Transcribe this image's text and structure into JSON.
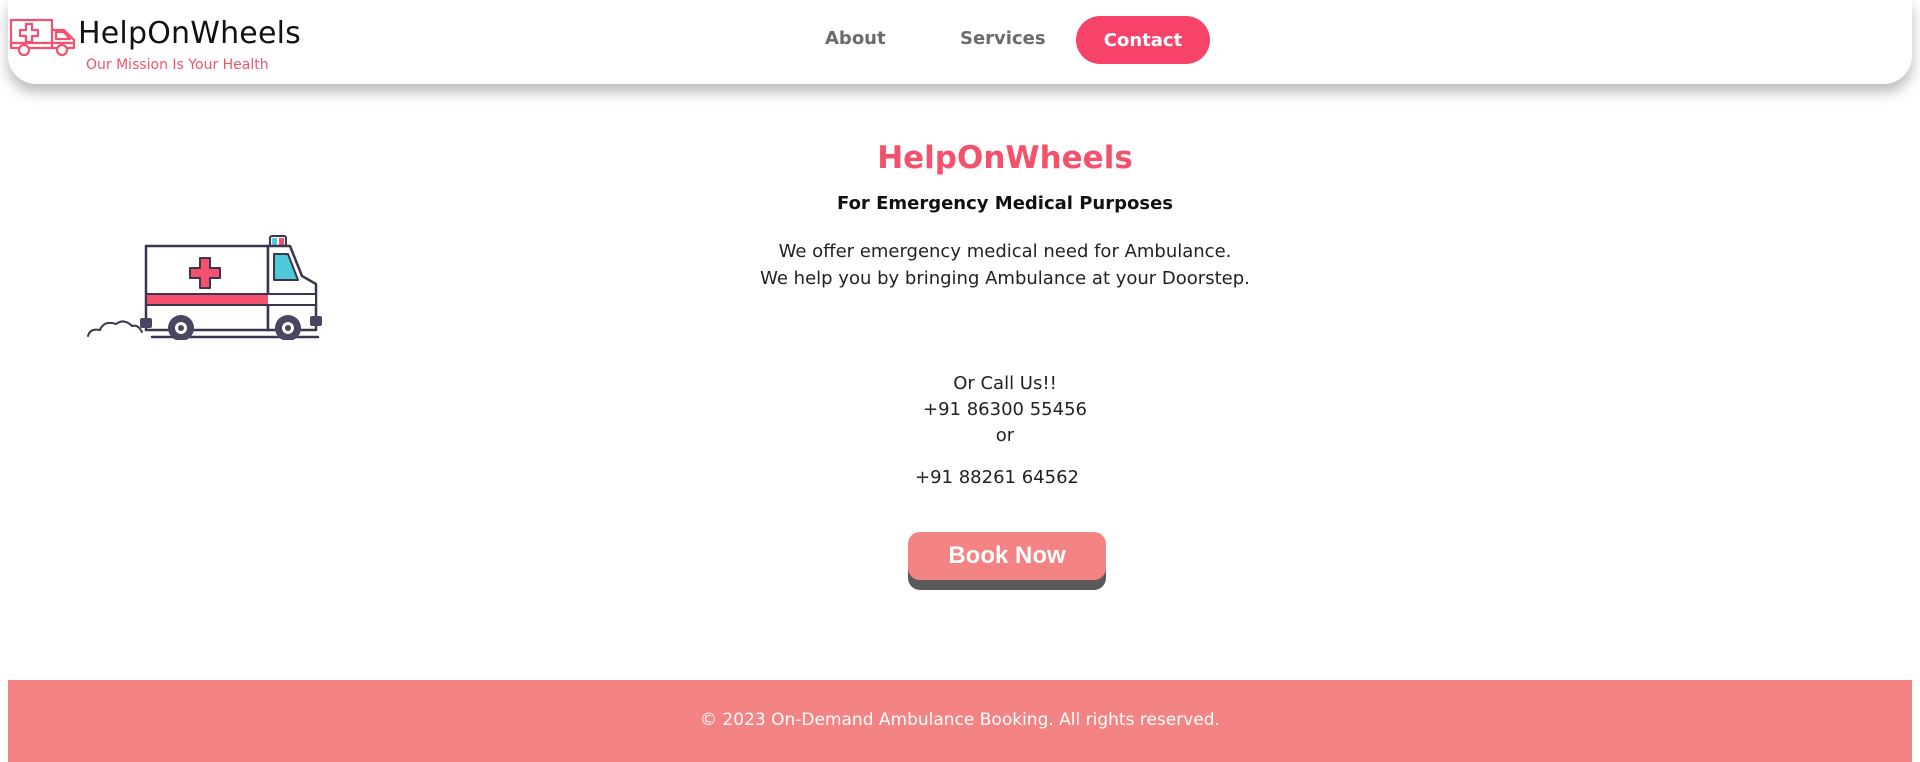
{
  "header": {
    "brand_name": "HelpOnWheels",
    "tagline": "Our Mission Is Your Health",
    "nav": {
      "about": "About",
      "services": "Services",
      "contact": "Contact"
    }
  },
  "hero": {
    "title": "HelpOnWheels",
    "subtitle": "For Emergency Medical Purposes",
    "desc_line1": "We offer emergency medical need for Ambulance.",
    "desc_line2": "We help you by bringing Ambulance at your Doorstep.",
    "call_label": "Or Call Us!!",
    "phone1": "+91 86300 55456",
    "or_text": "or",
    "phone2": "+91 88261 64562",
    "book_button": "Book Now"
  },
  "footer": {
    "copyright": "© 2023 On-Demand Ambulance Booking. All rights reserved."
  },
  "colors": {
    "accent": "#f4516c",
    "contact_button": "#f7436a",
    "book_button": "#f48383",
    "footer_bg": "#f48383"
  },
  "icons": {
    "logo": "ambulance-outline-icon",
    "illustration": "ambulance-illustration"
  }
}
